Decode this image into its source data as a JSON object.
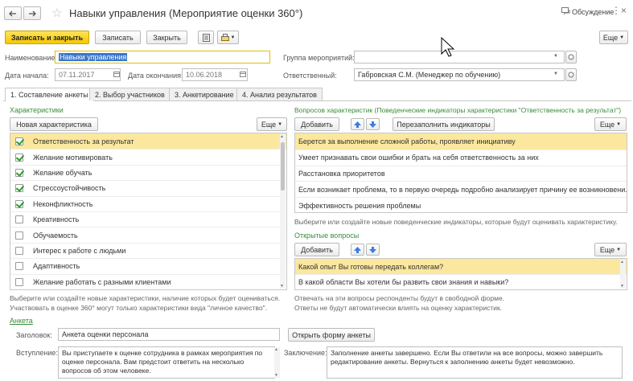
{
  "window": {
    "title": "Навыки управления (Мероприятие оценки 360°)",
    "discussion_label": "Обсуждение"
  },
  "toolbar": {
    "save_close": "Записать и закрыть",
    "save": "Записать",
    "close": "Закрыть",
    "more": "Еще"
  },
  "form": {
    "name_label": "Наименование:",
    "name_value": "Навыки управления",
    "group_label": "Группа мероприятий:",
    "group_value": "",
    "start_label": "Дата начала:",
    "start_value": "07.11.2017",
    "end_label": "Дата окончания:",
    "end_value": "10.06.2018",
    "responsible_label": "Ответственный:",
    "responsible_value": "Габровская С.М. (Менеджер по обучению)"
  },
  "tabs": [
    {
      "label": "1. Составление анкеты"
    },
    {
      "label": "2. Выбор участников"
    },
    {
      "label": "3. Анкетирование"
    },
    {
      "label": "4. Анализ результатов"
    }
  ],
  "characteristics": {
    "title": "Характеристики",
    "new_button": "Новая характеристика",
    "more": "Еще",
    "items": [
      {
        "label": "Ответственность за результат",
        "checked": true
      },
      {
        "label": "Желание мотивировать",
        "checked": true
      },
      {
        "label": "Желание обучать",
        "checked": true
      },
      {
        "label": "Стрессоустойчивость",
        "checked": true
      },
      {
        "label": "Неконфликтность",
        "checked": true
      },
      {
        "label": "Креативность",
        "checked": false
      },
      {
        "label": "Обучаемость",
        "checked": false
      },
      {
        "label": "Интерес к работе с людьми",
        "checked": false
      },
      {
        "label": "Адаптивность",
        "checked": false
      },
      {
        "label": "Желание работать с разными клиентами",
        "checked": false
      }
    ],
    "hint1": "Выберите или создайте новые характеристики, наличие которых будет оцениваться.",
    "hint2": "Участвовать в оценке 360° могут только характеристики вида \"личное качество\"."
  },
  "indicators": {
    "title": "Вопросов характеристик (Поведенческие индикаторы характеристики \"Ответственность за результат\")",
    "add_button": "Добавить",
    "refill_button": "Перезаполнить индикаторы",
    "more": "Еще",
    "items": [
      {
        "label": "Берется за выполнение сложной работы, проявляет инициативу"
      },
      {
        "label": "Умеет признавать свои ошибки и брать на себя ответственность за них"
      },
      {
        "label": "Расстановка приоритетов"
      },
      {
        "label": "Если возникает проблема, то в первую очередь подробно анализирует причину ее возникновени..."
      },
      {
        "label": "Эффективность решения проблемы"
      }
    ],
    "hint": "Выберите или создайте новые поведенческие индикаторы, которые будут оценивать характеристику."
  },
  "open_questions": {
    "title": "Открытые вопросы",
    "add_button": "Добавить",
    "more": "Еще",
    "items": [
      {
        "label": "Какой опыт Вы готовы передать коллегам?"
      },
      {
        "label": "В какой области Вы хотели бы развить свои знания и навыки?"
      }
    ],
    "hint1": "Отвечать на эти вопросы респонденты будут в свободной форме.",
    "hint2": "Ответы не будут автоматически влиять на оценку характеристик."
  },
  "questionnaire": {
    "section": "Анкета",
    "header_label": "Заголовок:",
    "header_value": "Анкета оценки персонала",
    "open_form_button": "Открыть форму анкеты",
    "intro_label": "Вступление:",
    "intro_text": "Вы приступаете к оценке сотрудника в рамках мероприятия по оценке персонала. Вам предстоит ответить на несколько вопросов об этом человеке.",
    "outro_label": "Заключение:",
    "outro_text": "Заполнение анкеты завершено. Если Вы ответили на все вопросы, можно завершить редактирование анкеты. Вернуться к заполнению анкеты будет невозможно."
  }
}
